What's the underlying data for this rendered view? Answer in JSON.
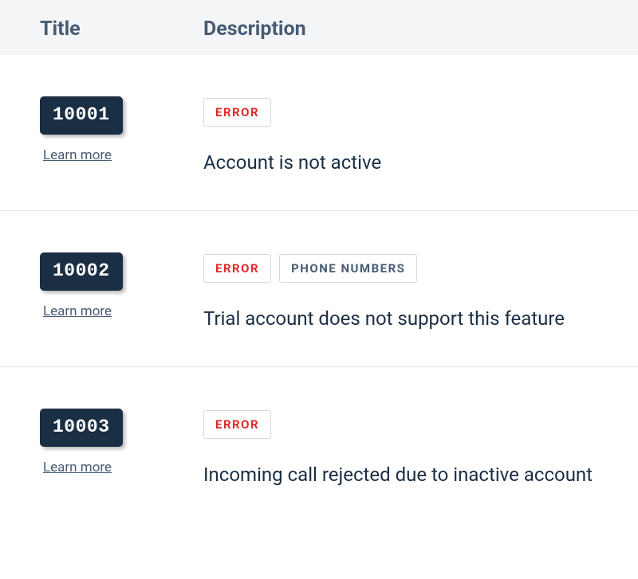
{
  "header": {
    "title_label": "Title",
    "description_label": "Description"
  },
  "learn_more_label": "Learn more",
  "rows": [
    {
      "code": "10001",
      "tags": [
        {
          "text": "ERROR",
          "kind": "error"
        }
      ],
      "description": "Account is not active"
    },
    {
      "code": "10002",
      "tags": [
        {
          "text": "ERROR",
          "kind": "error"
        },
        {
          "text": "PHONE NUMBERS",
          "kind": "default"
        }
      ],
      "description": "Trial account does not support this feature"
    },
    {
      "code": "10003",
      "tags": [
        {
          "text": "ERROR",
          "kind": "error"
        }
      ],
      "description": "Incoming call rejected due to inactive account"
    }
  ]
}
